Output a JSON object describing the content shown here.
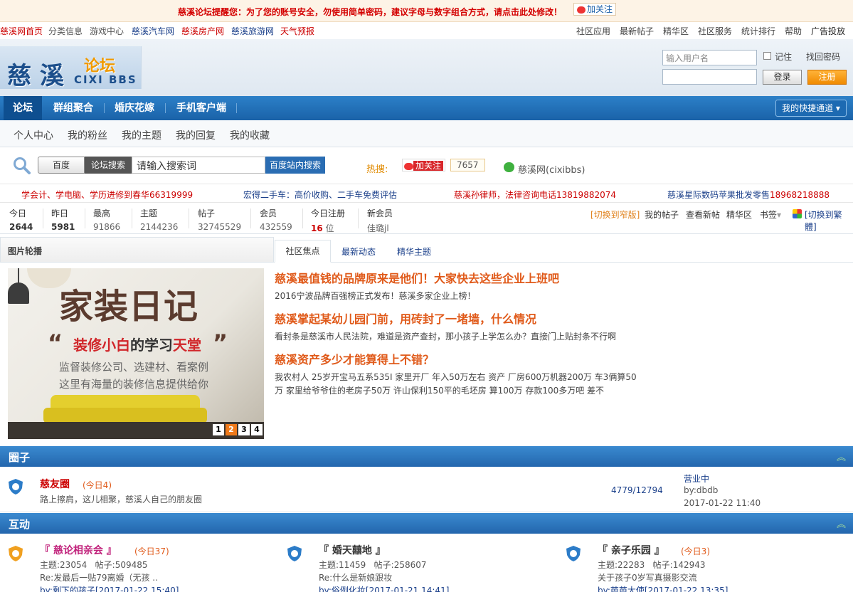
{
  "notice": {
    "text": "慈溪论坛提醒您：为了您的账号安全，勿使用简单密码，建议字母与数字组合方式，请点击此处修改！",
    "follow": "加关注"
  },
  "toplinks": {
    "left": [
      "慈溪网首页",
      "分类信息",
      "游戏中心",
      "慈溪汽车网",
      "慈溪房产网",
      "慈溪旅游网",
      "天气预报"
    ],
    "right": [
      "社区应用",
      "最新帖子",
      "精华区",
      "社区服务",
      "统计排行",
      "帮助",
      "广告投放"
    ]
  },
  "logo": {
    "cn": "慈溪",
    "lt": "论坛",
    "en": "CIXI BBS"
  },
  "login": {
    "username_placeholder": "输入用户名",
    "remember": "记住",
    "forgot": "找回密码",
    "login_btn": "登录",
    "register_btn": "注册"
  },
  "nav": {
    "items": [
      "论坛",
      "群组聚合",
      "婚庆花嫁",
      "手机客户端"
    ],
    "quick": "我的快捷通道"
  },
  "subnav": [
    "个人中心",
    "我的粉丝",
    "我的主题",
    "我的回复",
    "我的收藏"
  ],
  "search": {
    "tab_baidu": "百度",
    "tab_forum": "论坛搜索",
    "placeholder": "请输入搜索词",
    "button": "百度站内搜索",
    "hot_label": "热搜:",
    "follow": "加关注",
    "follow_count": "7657",
    "wechat": "慈溪网(cixibbs)"
  },
  "ads": [
    {
      "text": "学会计、学电脑、学历进修到春华",
      "phone": "66319999"
    },
    {
      "text": "宏得二手车：高价收购、二手车免费评估",
      "phone": ""
    },
    {
      "text": "慈溪孙律师，法律咨询电话",
      "phone": "13819882074"
    },
    {
      "text": "慈溪星际数码苹果批发零售",
      "phone": "18968218888"
    }
  ],
  "stats": {
    "today_label": "今日",
    "today": "2644",
    "yesterday_label": "昨日",
    "yesterday": "5981",
    "max_label": "最高",
    "max": "91866",
    "topics_label": "主题",
    "topics": "2144236",
    "posts_label": "帖子",
    "posts": "32745529",
    "members_label": "会员",
    "members": "432559",
    "reg_label": "今日注册",
    "reg": "16",
    "reg_unit": "位",
    "newmember_label": "新会员",
    "newmember": "佳璐jl"
  },
  "stats_links": {
    "narrow": "[切换到窄版]",
    "items": [
      "我的帖子",
      "查看新帖",
      "精华区",
      "书签"
    ],
    "trad": "[切换到繁體]"
  },
  "portal": {
    "slide_head": "图片轮播",
    "tabs": [
      "社区焦点",
      "最新动态",
      "精华主题"
    ],
    "slide": {
      "title": "家装日记",
      "sub1": "装修小白",
      "sub2": "的学习",
      "sub3": "天堂",
      "line1": "监督装修公司、选建材、看案例",
      "line2": "这里有海量的装修信息提供给你",
      "pages": [
        "1",
        "2",
        "3",
        "4"
      ]
    },
    "news": [
      {
        "title": "慈溪最值钱的品牌原来是他们！大家快去这些企业上班吧",
        "desc": [
          "2016宁波品牌百强榜正式发布！慈溪多家企业上榜！"
        ]
      },
      {
        "title": "慈溪掌起某幼儿园门前，用砖封了一堵墙，什么情况",
        "desc": [
          "看封条是慈溪市人民法院，难道是资产查封，那小孩子上学怎么办？直接门上贴封条不行啊"
        ]
      },
      {
        "title": "慈溪资产多少才能算得上不错？",
        "desc": [
          "我农村人 25岁开宝马五系535I 家里开厂 年入50万左右 资产 厂房600万机器200万 车3俩算50",
          "万 家里给爷爷住的老房子50万 许山保利150平的毛坯房 算100万 存款100多万吧 差不"
        ]
      }
    ]
  },
  "section_circle": {
    "title": "圈子",
    "forum": {
      "name": "慈友圈",
      "today": "(今日4)",
      "desc": "路上擦肩，这儿相聚，慈溪人自己的朋友圈",
      "counts": "4779/12794",
      "last_title": "营业中",
      "last_by": "by:dbdb",
      "last_time": "2017-01-22 11:40"
    }
  },
  "section_interact": {
    "title": "互动",
    "forums": [
      {
        "name": "『 慈论相亲会 』",
        "today": "(今日37)",
        "stat": "主题:23054   帖子:509485",
        "last": "Re:发最后一贴79离婚（无孩 ..",
        "by": "by:剩下的孩子[2017-01-22 15:40]"
      },
      {
        "name": "『 婚天囍地 』",
        "today": "",
        "stat": "主题:11459   帖子:258607",
        "last": "Re:什么是新娘跟妆",
        "by": "by:俗例化妆[2017-01-21 14:41]"
      },
      {
        "name": "『 亲子乐园 』",
        "today": "(今日3)",
        "stat": "主题:22283   帖子:142943",
        "last": "关于孩子0岁写真摄影交流",
        "by": "by:芭芭大使[2017-01-22 13:35]"
      }
    ]
  },
  "colors": {
    "nav": "#1a62a8",
    "accent": "#e05a1a",
    "red": "#d40000",
    "orange_btn": "#f08a00"
  }
}
